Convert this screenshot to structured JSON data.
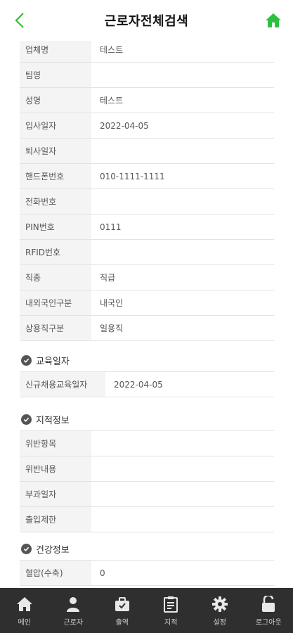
{
  "header": {
    "title": "근로자전체검색"
  },
  "colors": {
    "accent": "#2fbf3f",
    "tabbar": "#2f2f2f"
  },
  "info_rows": [
    {
      "label": "업체명",
      "value": "테스트"
    },
    {
      "label": "팀명",
      "value": ""
    },
    {
      "label": "성명",
      "value": "테스트"
    },
    {
      "label": "입사일자",
      "value": "2022-04-05"
    },
    {
      "label": "퇴사일자",
      "value": ""
    },
    {
      "label": "핸드폰번호",
      "value": "010-1111-1111"
    },
    {
      "label": "전화번호",
      "value": ""
    },
    {
      "label": "PIN번호",
      "value": "0111"
    },
    {
      "label": "RFID번호",
      "value": ""
    },
    {
      "label": "직종",
      "value": "직급"
    },
    {
      "label": "내외국인구분",
      "value": "내국인"
    },
    {
      "label": "상용직구분",
      "value": "일용직"
    }
  ],
  "education": {
    "title": "교육일자",
    "rows": [
      {
        "label": "신규채용교육일자",
        "value": "2022-04-05"
      }
    ]
  },
  "violation": {
    "title": "지적정보",
    "rows": [
      {
        "label": "위반항목",
        "value": ""
      },
      {
        "label": "위반내용",
        "value": ""
      },
      {
        "label": "부과일자",
        "value": ""
      },
      {
        "label": "출입제한",
        "value": ""
      }
    ]
  },
  "health": {
    "title": "건강정보",
    "rows": [
      {
        "label": "혈압(수축)",
        "value": "0"
      }
    ]
  },
  "tabbar": {
    "items": [
      {
        "label": "메인",
        "icon": "home-icon"
      },
      {
        "label": "근로자",
        "icon": "worker-icon"
      },
      {
        "label": "출역",
        "icon": "briefcase-icon"
      },
      {
        "label": "지적",
        "icon": "clipboard-icon"
      },
      {
        "label": "설정",
        "icon": "gear-icon"
      },
      {
        "label": "로그아웃",
        "icon": "unlock-icon"
      }
    ]
  }
}
